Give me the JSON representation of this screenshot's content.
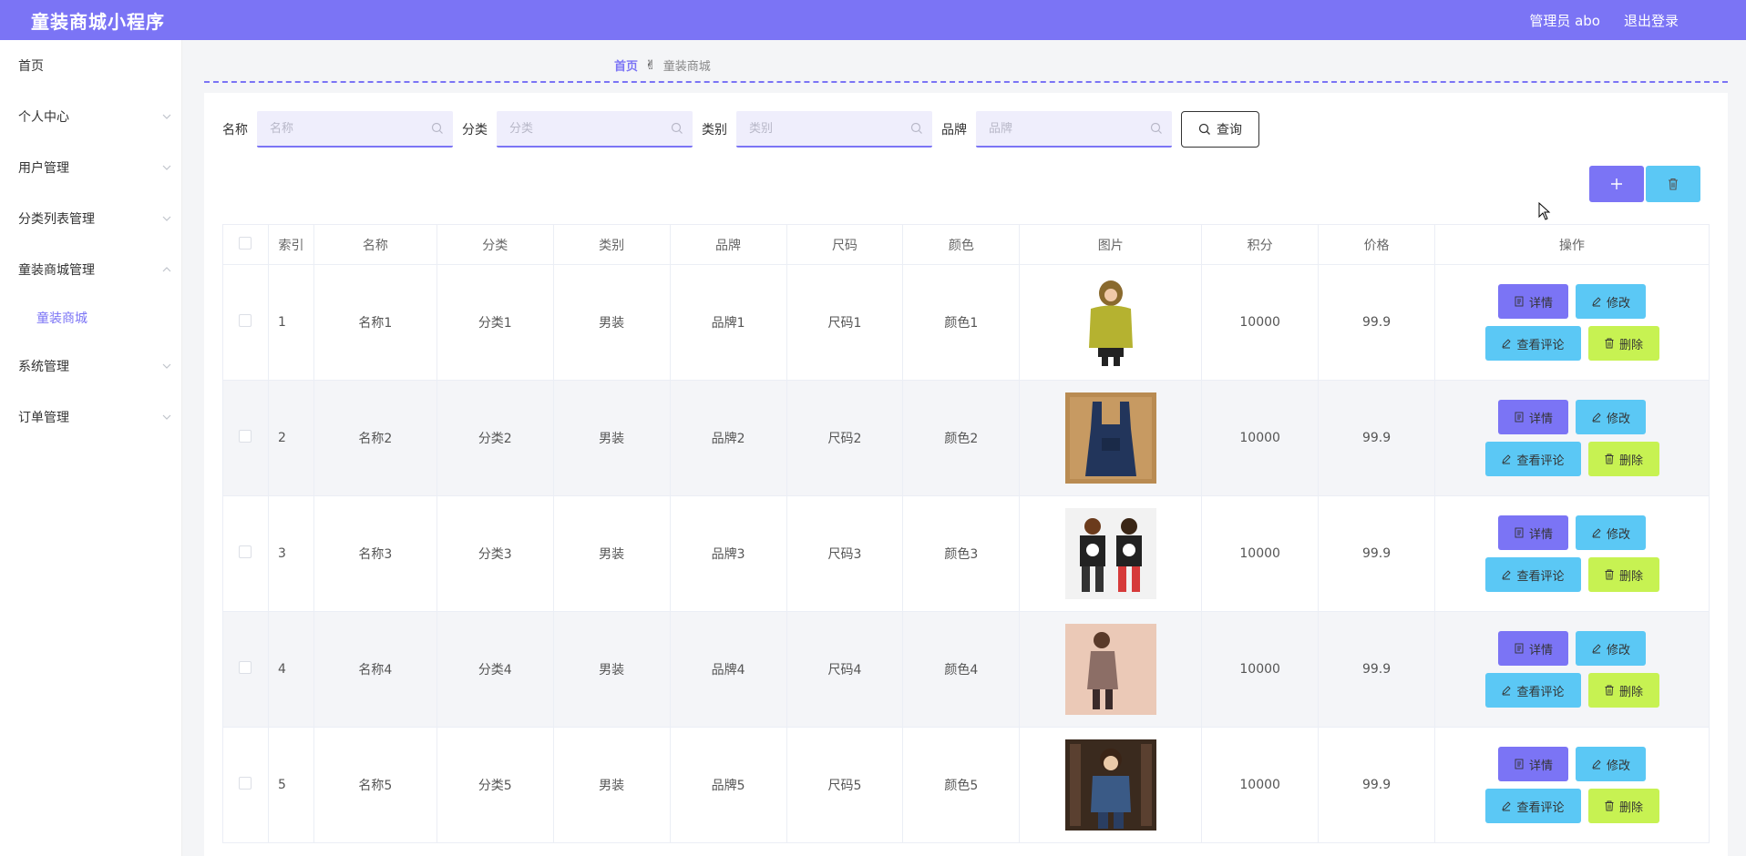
{
  "app": {
    "title": "童装商城小程序",
    "admin_label": "管理员 abo",
    "logout_label": "退出登录"
  },
  "sidebar": {
    "items": [
      {
        "label": "首页",
        "has_chevron": false
      },
      {
        "label": "个人中心",
        "has_chevron": true
      },
      {
        "label": "用户管理",
        "has_chevron": true
      },
      {
        "label": "分类列表管理",
        "has_chevron": true
      },
      {
        "label": "童装商城管理",
        "has_chevron": true,
        "expanded": true
      },
      {
        "label": "系统管理",
        "has_chevron": true
      },
      {
        "label": "订单管理",
        "has_chevron": true
      }
    ],
    "sub_item": "童装商城"
  },
  "breadcrumb": {
    "home": "首页",
    "current": "童装商城"
  },
  "search": {
    "name_label": "名称",
    "name_placeholder": "名称",
    "category_label": "分类",
    "category_placeholder": "分类",
    "type_label": "类别",
    "type_placeholder": "类别",
    "brand_label": "品牌",
    "brand_placeholder": "品牌",
    "query_label": "查询"
  },
  "table": {
    "headers": [
      "索引",
      "名称",
      "分类",
      "类别",
      "品牌",
      "尺码",
      "颜色",
      "图片",
      "积分",
      "价格",
      "操作"
    ],
    "rows": [
      {
        "index": "1",
        "name": "名称1",
        "category": "分类1",
        "type": "男装",
        "brand": "品牌1",
        "size": "尺码1",
        "color": "颜色1",
        "points": "10000",
        "price": "99.9"
      },
      {
        "index": "2",
        "name": "名称2",
        "category": "分类2",
        "type": "男装",
        "brand": "品牌2",
        "size": "尺码2",
        "color": "颜色2",
        "points": "10000",
        "price": "99.9"
      },
      {
        "index": "3",
        "name": "名称3",
        "category": "分类3",
        "type": "男装",
        "brand": "品牌3",
        "size": "尺码3",
        "color": "颜色3",
        "points": "10000",
        "price": "99.9"
      },
      {
        "index": "4",
        "name": "名称4",
        "category": "分类4",
        "type": "男装",
        "brand": "品牌4",
        "size": "尺码4",
        "color": "颜色4",
        "points": "10000",
        "price": "99.9"
      },
      {
        "index": "5",
        "name": "名称5",
        "category": "分类5",
        "type": "男装",
        "brand": "品牌5",
        "size": "尺码5",
        "color": "颜色5",
        "points": "10000",
        "price": "99.9"
      }
    ],
    "ops": {
      "detail": "详情",
      "edit": "修改",
      "review": "查看评论",
      "remove": "删除"
    }
  },
  "colors": {
    "primary": "#7b74f5",
    "secondary": "#5bc8f5",
    "accent": "#c7f252"
  },
  "icons": {
    "add": "plus-icon",
    "delete": "trash-icon",
    "search": "search-icon"
  }
}
